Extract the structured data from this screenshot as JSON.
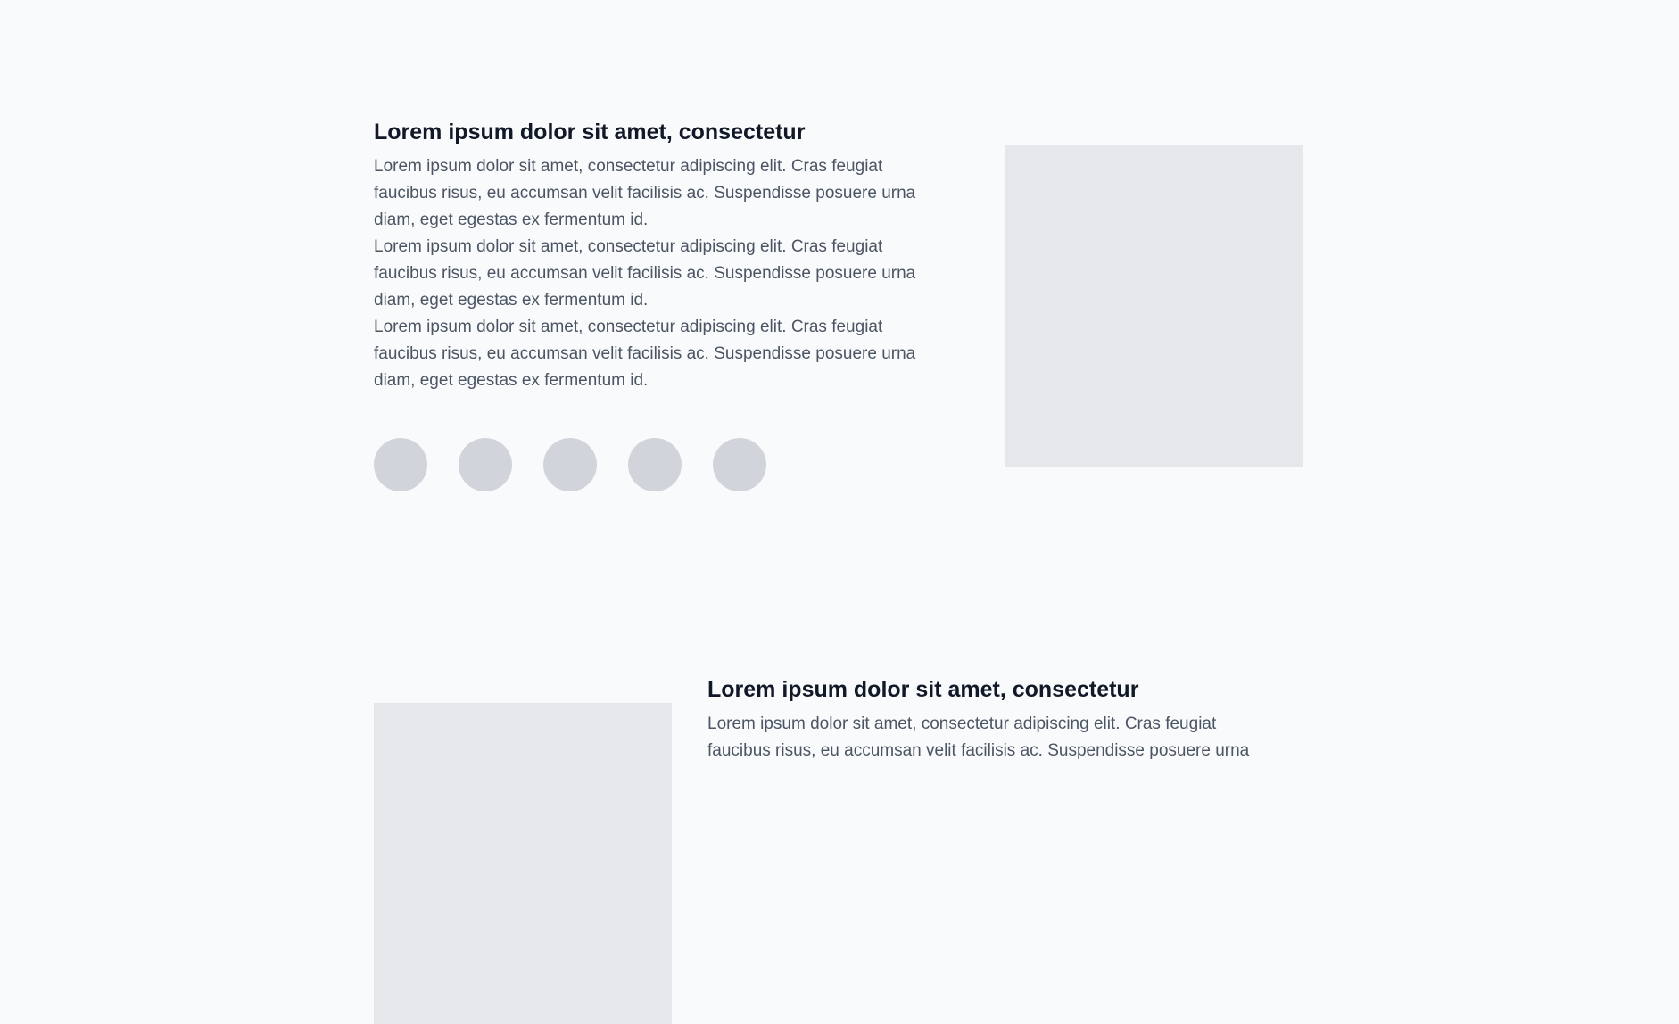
{
  "colors": {
    "background": "#f9fafb",
    "heading": "#111827",
    "body_text": "#4b5563",
    "image_placeholder": "#e5e7eb",
    "circle_placeholder": "#d1d5db"
  },
  "section1": {
    "title": "Lorem ipsum dolor sit amet, consectetur",
    "paragraphs": [
      "Lorem ipsum dolor sit amet, consectetur adipiscing elit. Cras feugiat faucibus risus, eu accumsan velit facilisis ac. Suspendisse posuere urna diam, eget egestas ex fermentum id.",
      "Lorem ipsum dolor sit amet, consectetur adipiscing elit. Cras feugiat faucibus risus, eu accumsan velit facilisis ac. Suspendisse posuere urna diam, eget egestas ex fermentum id.",
      "Lorem ipsum dolor sit amet, consectetur adipiscing elit. Cras feugiat faucibus risus, eu accumsan velit facilisis ac. Suspendisse posuere urna diam, eget egestas ex fermentum id."
    ]
  },
  "section2": {
    "title": "Lorem ipsum dolor sit amet, consectetur",
    "paragraphs": [
      "Lorem ipsum dolor sit amet, consectetur adipiscing elit. Cras feugiat faucibus risus, eu accumsan velit facilisis ac. Suspendisse posuere urna"
    ]
  }
}
